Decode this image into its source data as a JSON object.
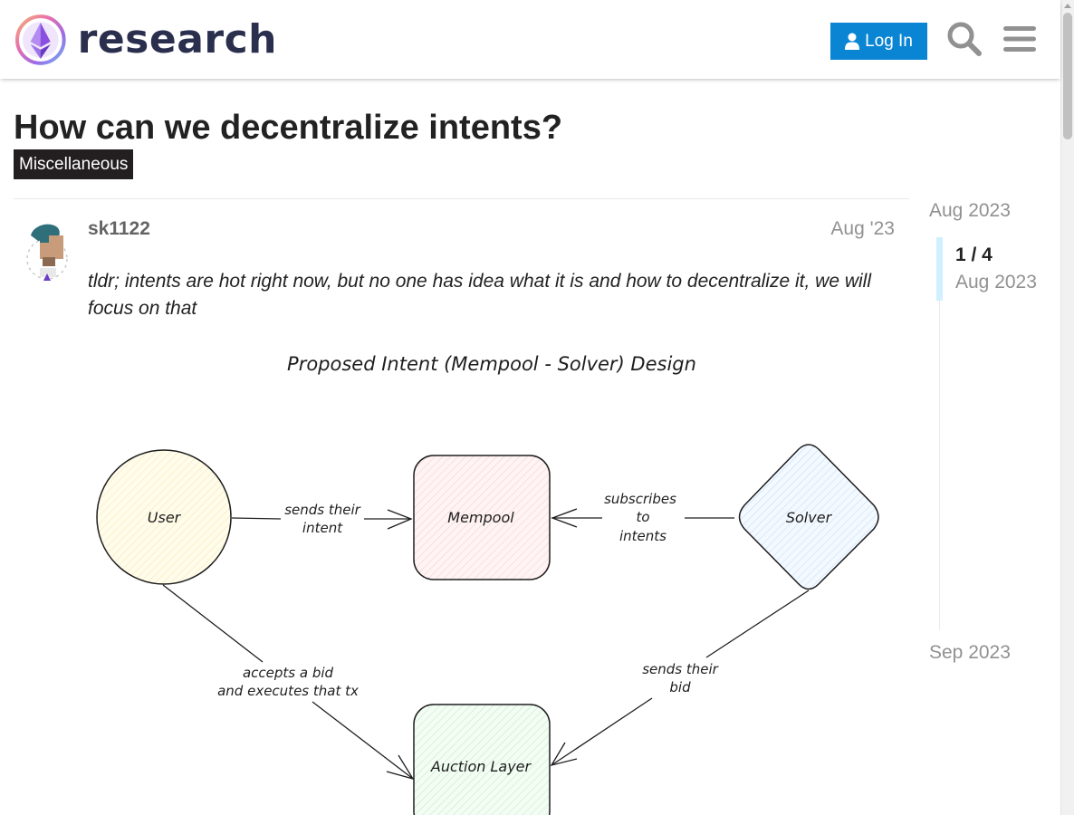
{
  "site": {
    "name": "research"
  },
  "header": {
    "login_label": "Log In",
    "search_icon": "search-icon",
    "menu_icon": "hamburger-menu-icon"
  },
  "topic": {
    "title": "How can we decentralize intents?",
    "category": "Miscellaneous"
  },
  "post": {
    "username": "sk1122",
    "date": "Aug '23",
    "body": "tldr; intents are hot right now, but no one has idea what it is and how to decentralize it, we will focus on that",
    "diagram": {
      "title": "Proposed Intent (Mempool - Solver) Design",
      "nodes": {
        "user": "User",
        "mempool": "Mempool",
        "solver": "Solver",
        "auction": "Auction Layer"
      },
      "edges": {
        "user_to_mempool": [
          "sends their",
          "intent"
        ],
        "solver_to_mempool": [
          "subscribes",
          "to",
          "intents"
        ],
        "user_to_auction": [
          "accepts a bid",
          "and executes that tx"
        ],
        "solver_to_auction": [
          "sends their",
          "bid"
        ]
      }
    }
  },
  "timeline": {
    "start": "Aug 2023",
    "position": "1 / 4",
    "position_date": "Aug 2023",
    "end": "Sep 2023"
  },
  "colors": {
    "brand_blue": "#0a85d4",
    "category_bg": "#231f20",
    "timeline_handle": "#d1f0ff",
    "user_fill": "#fff9db",
    "mempool_fill": "#ffecec",
    "solver_fill": "#e7f5ff",
    "auction_fill": "#ebfbee"
  }
}
